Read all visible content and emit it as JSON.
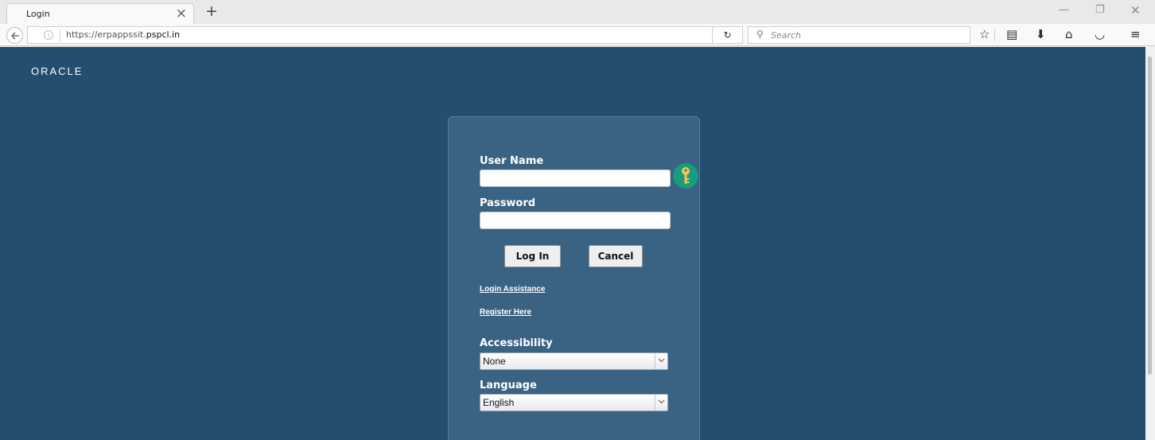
{
  "browser": {
    "tab_title": "Login",
    "url_prefix": "https://erpappssit.",
    "url_domain": "pspcl.in",
    "search_placeholder": "Search"
  },
  "brand": {
    "logo_text": "ORACLE"
  },
  "login_form": {
    "username_label": "User Name",
    "username_value": "",
    "password_label": "Password",
    "password_value": "",
    "login_button": "Log In",
    "cancel_button": "Cancel",
    "login_assistance_link": "Login Assistance",
    "register_link": "Register Here",
    "accessibility_label": "Accessibility",
    "accessibility_value": "None",
    "language_label": "Language",
    "language_value": "English"
  },
  "colors": {
    "page_background": "#234e6f",
    "panel_background": "#3a6283",
    "key_icon": "#179c7e"
  }
}
